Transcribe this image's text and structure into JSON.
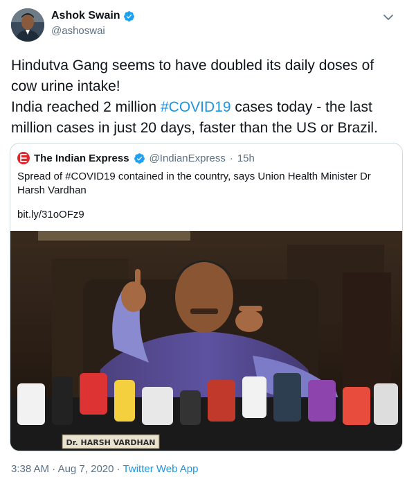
{
  "author": {
    "name": "Ashok Swain",
    "handle": "@ashoswai"
  },
  "tweet": {
    "line1": "Hindutva Gang seems to have doubled its daily doses of cow urine intake!",
    "line2_before": "India reached 2 million ",
    "hashtag": "#COVID19",
    "line2_after": " cases today - the last million cases in just 20 days, faster than the US or Brazil."
  },
  "quoted": {
    "name": "The Indian Express",
    "handle": "@IndianExpress",
    "separator": "·",
    "time": "15h",
    "text": "Spread of #COVID19 contained in the country, says Union Health Minister Dr Harsh Vardhan",
    "link": "bit.ly/31oOFz9",
    "image_nameplate": "Dr. HARSH VARDHAN"
  },
  "meta": {
    "time": "3:38 AM",
    "dot": "·",
    "date": "Aug 7, 2020",
    "dot2": "·",
    "source": "Twitter Web App"
  },
  "colors": {
    "link": "#1b95e0",
    "verified": "#1da1f2",
    "secondary_text": "#5b7083",
    "border": "#cfd9de",
    "express_red": "#e0262b"
  },
  "icons": [
    "verified-badge-icon",
    "chevron-down-icon",
    "indian-express-logo-icon"
  ]
}
